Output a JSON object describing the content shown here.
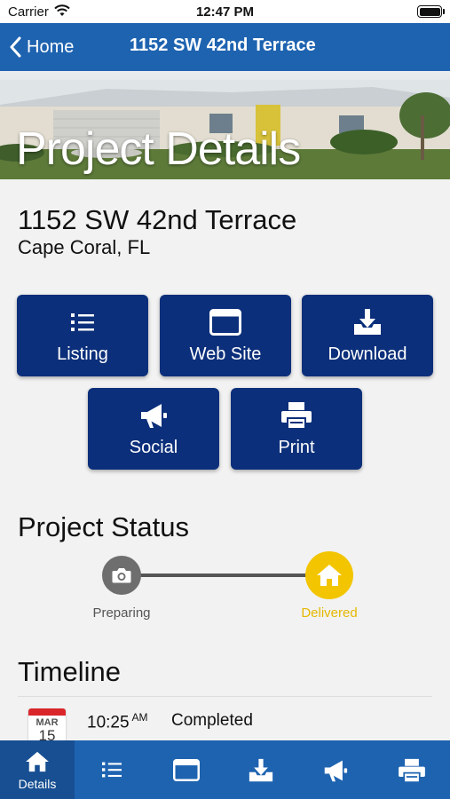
{
  "status_bar": {
    "carrier": "Carrier",
    "time": "12:47 PM"
  },
  "nav": {
    "back_label": "Home",
    "title": "1152 SW 42nd Terrace"
  },
  "hero": {
    "title": "Project Details"
  },
  "address": {
    "street": "1152 SW 42nd Terrace",
    "city": "Cape Coral, FL"
  },
  "actions": [
    {
      "label": "Listing",
      "icon": "list-icon"
    },
    {
      "label": "Web Site",
      "icon": "browser-window-icon"
    },
    {
      "label": "Download",
      "icon": "download-icon"
    },
    {
      "label": "Social",
      "icon": "megaphone-icon"
    },
    {
      "label": "Print",
      "icon": "printer-icon"
    }
  ],
  "project_status": {
    "title": "Project Status",
    "steps": [
      {
        "label": "Preparing",
        "icon": "camera-icon",
        "color": "#6e6e6e"
      },
      {
        "label": "Delivered",
        "icon": "home-icon",
        "color": "#f2c500"
      }
    ]
  },
  "timeline": {
    "title": "Timeline",
    "entries": [
      {
        "month": "MAR",
        "day": "15",
        "time": "10:25",
        "ampm": "AM",
        "text": "Completed"
      }
    ]
  },
  "tabbar": {
    "tabs": [
      {
        "label": "Details",
        "icon": "home-icon",
        "active": true
      },
      {
        "label": "",
        "icon": "list-icon"
      },
      {
        "label": "",
        "icon": "browser-window-icon"
      },
      {
        "label": "",
        "icon": "download-icon"
      },
      {
        "label": "",
        "icon": "megaphone-icon"
      },
      {
        "label": "",
        "icon": "printer-icon"
      }
    ]
  },
  "colors": {
    "nav_blue": "#1e63b0",
    "button_navy": "#0b2f7a",
    "delivered_yellow": "#f2c500",
    "preparing_gray": "#6e6e6e"
  }
}
